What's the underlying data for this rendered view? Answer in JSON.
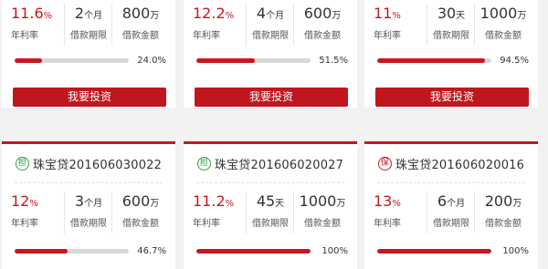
{
  "labels": {
    "rate": "年利率",
    "term": "借款期限",
    "amount": "借款金额"
  },
  "top_cards": [
    {
      "rate": "11.6",
      "rate_unit": "%",
      "term": "2",
      "term_unit": "个月",
      "amount": "800",
      "amount_unit": "万",
      "progress": 24.0,
      "progress_label": "24.0%",
      "button": "我要投资"
    },
    {
      "rate": "12.2",
      "rate_unit": "%",
      "term": "4",
      "term_unit": "个月",
      "amount": "600",
      "amount_unit": "万",
      "progress": 51.5,
      "progress_label": "51.5%",
      "button": "我要投资"
    },
    {
      "rate": "11",
      "rate_unit": "%",
      "term": "30",
      "term_unit": "天",
      "amount": "1000",
      "amount_unit": "万",
      "progress": 94.5,
      "progress_label": "94.5%",
      "button": "我要投资"
    }
  ],
  "bottom_cards": [
    {
      "badge": "担",
      "badge_color": "#2e9d3f",
      "title": "珠宝贷201606030022",
      "rate": "12",
      "rate_unit": "%",
      "term": "3",
      "term_unit": "个月",
      "amount": "600",
      "amount_unit": "万",
      "progress": 46.7,
      "progress_label": "46.7%"
    },
    {
      "badge": "担",
      "badge_color": "#2e9d3f",
      "title": "珠宝贷201606020027",
      "rate": "11.2",
      "rate_unit": "%",
      "term": "45",
      "term_unit": "天",
      "amount": "1000",
      "amount_unit": "万",
      "progress": 100,
      "progress_label": "100%"
    },
    {
      "badge": "保",
      "badge_color": "#c8161d",
      "title": "珠宝贷201606020016",
      "rate": "13",
      "rate_unit": "%",
      "term": "6",
      "term_unit": "个月",
      "amount": "200",
      "amount_unit": "万",
      "progress": 100,
      "progress_label": "100%"
    }
  ],
  "colors": {
    "accent": "#c8161d",
    "track": "#d8d8d8",
    "background": "#f2f2f2"
  }
}
